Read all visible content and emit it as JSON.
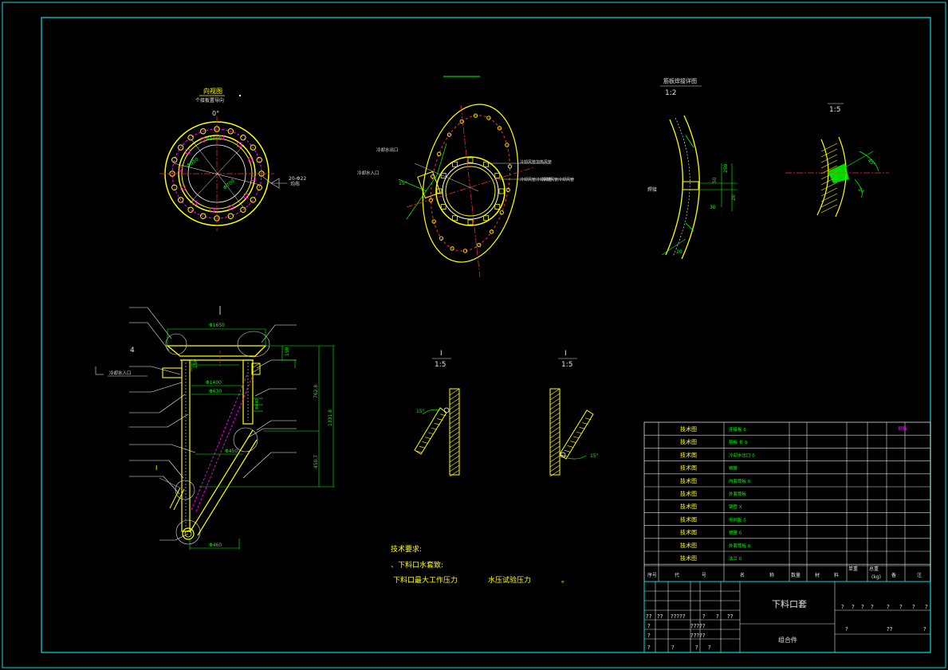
{
  "colors": {
    "background": "#000000",
    "frame": "#00e0e0",
    "part": "#ffff00",
    "text": "#e0e0e0",
    "dimension": "#00ff00",
    "centerline": "#ff3030",
    "hidden": "#ff00ff",
    "hatch": "#00ff00"
  },
  "views": {
    "top_view_title": "向视图",
    "top_view_subtitle": "个接板置导向",
    "top_view_angle": "0°",
    "top_view_holes": "20-Φ22",
    "top_view_hole_note": "均布",
    "top_view_dims": [
      "Φ1000",
      "Φ950",
      "Φ700"
    ],
    "oval_view_labels": [
      "冷却水出口",
      "冷却水入口",
      "冷却风管加热风管",
      "冷却风管冷却风管",
      "冷却风管冷却风管"
    ],
    "oval_view_angle": "15°",
    "detail_a_title": "筋板焊接详图",
    "detail_a_scale": "1:2",
    "detail_a_note": "焊接",
    "detail_a_dims": [
      "250",
      "30",
      "20",
      "50",
      "20"
    ],
    "detail_b_scale": "1:5",
    "detail_b_dims": [
      "45°",
      "24"
    ],
    "section_label": "4",
    "section_water_outlet": "冷却水出口",
    "section_water_inlet": "冷却水入口",
    "section_dims": [
      "Φ1650",
      "Φ1400",
      "Φ630",
      "Φ450",
      "Φ440",
      "Φ460",
      "150",
      "150",
      "762.8",
      "1331.8",
      "450.7"
    ],
    "section_detail_mark": "I",
    "detail_i_left_mark": "I",
    "detail_i_left_scale": "1:5",
    "detail_i_left_angle": "15°",
    "detail_i_right_mark": "I",
    "detail_i_right_scale": "1:5",
    "detail_i_right_angle": "15°"
  },
  "notes": {
    "title": "技术要求:",
    "line1": "、下料口水套致:",
    "line2_prefix": "下料口最大工作压力",
    "line2_suffix": "水压试验压力",
    "line2_end": "。"
  },
  "bom": {
    "header_right": "钢板",
    "rows": [
      {
        "code": "技术图",
        "name": "连接板   δ"
      },
      {
        "code": "技术图",
        "name": "筋板     长  δ"
      },
      {
        "code": "技术图",
        "name": "冷却水出口  δ"
      },
      {
        "code": "技术图",
        "name": "钢管"
      },
      {
        "code": "技术图",
        "name": "内套筒板 δ"
      },
      {
        "code": "技术图",
        "name": "外套筒板"
      },
      {
        "code": "技术图",
        "name": "钢管     X"
      },
      {
        "code": "技术图",
        "name": "中间板  δ"
      },
      {
        "code": "技术图",
        "name": "钢管              δ"
      },
      {
        "code": "技术图",
        "name": "外套筒板 δ"
      },
      {
        "code": "技术图",
        "name": "法兰  δ"
      }
    ],
    "columns": [
      "序号",
      "代",
      "号",
      "名",
      "称",
      "数量",
      "材",
      "料",
      "单重",
      "总重",
      "(kg)",
      "备",
      "注"
    ]
  },
  "title_block": {
    "part_name": "下料口套",
    "part_type": "组合件",
    "row_a": [
      "??",
      "??",
      "?????",
      "?",
      "?",
      "??"
    ],
    "row_b": [
      "?",
      "?????"
    ],
    "row_c": [
      "?",
      "?????"
    ],
    "row_d": [
      "?",
      "?",
      "?",
      "?"
    ],
    "right_top": [
      "?",
      "?",
      "?",
      "?",
      "?",
      "?",
      "?",
      "?"
    ],
    "right_bottom": [
      "?",
      "??",
      "?"
    ]
  }
}
